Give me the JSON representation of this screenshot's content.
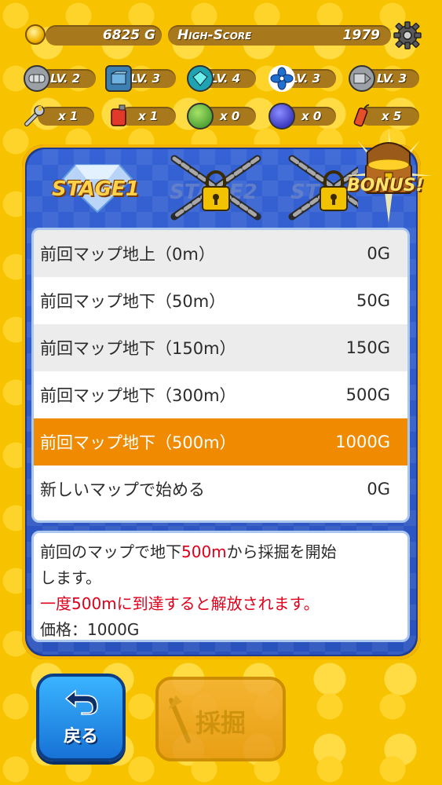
{
  "header": {
    "coins": "6825 G",
    "high_score_label": "High-Score",
    "high_score": "1979"
  },
  "upgrades": [
    {
      "icon": "pipe-icon",
      "level": "LV. 2"
    },
    {
      "icon": "crate-icon",
      "level": "LV. 3"
    },
    {
      "icon": "gem-tool-icon",
      "level": "LV. 4"
    },
    {
      "icon": "fan-icon",
      "level": "LV. 3"
    },
    {
      "icon": "drill-icon",
      "level": "LV. 3"
    }
  ],
  "items": [
    {
      "icon": "wrench-icon",
      "count": "x 1"
    },
    {
      "icon": "fuel-can-icon",
      "count": "x 1"
    },
    {
      "icon": "green-orb-icon",
      "count": "x 0"
    },
    {
      "icon": "blue-orb-icon",
      "count": "x 0"
    },
    {
      "icon": "dynamite-icon",
      "count": "x 5"
    }
  ],
  "stages": {
    "stage1": "STAGE1",
    "stage2": "STAGE2",
    "stage3": "ST",
    "bonus": "BONUS!"
  },
  "map_options": [
    {
      "label": "前回マップ地上（0m）",
      "price": "0G"
    },
    {
      "label": "前回マップ地下（50m）",
      "price": "50G"
    },
    {
      "label": "前回マップ地下（150m）",
      "price": "150G"
    },
    {
      "label": "前回マップ地下（300m）",
      "price": "500G"
    },
    {
      "label": "前回マップ地下（500m）",
      "price": "1000G"
    },
    {
      "label": "新しいマップで始める",
      "price": "0G"
    }
  ],
  "description": {
    "line1_a": "前回のマップで地下",
    "line1_red": "500m",
    "line1_b": "から採掘を開始",
    "line2": "します。",
    "line3": "一度500mに到達すると解放されます。",
    "line4": "価格：1000G"
  },
  "buttons": {
    "back": "戻る",
    "dig": "採掘"
  },
  "colors": {
    "background": "#f7c200",
    "selected_row": "#f08a00",
    "panel": "#2a52bc",
    "highlight_text": "#e0001b"
  }
}
